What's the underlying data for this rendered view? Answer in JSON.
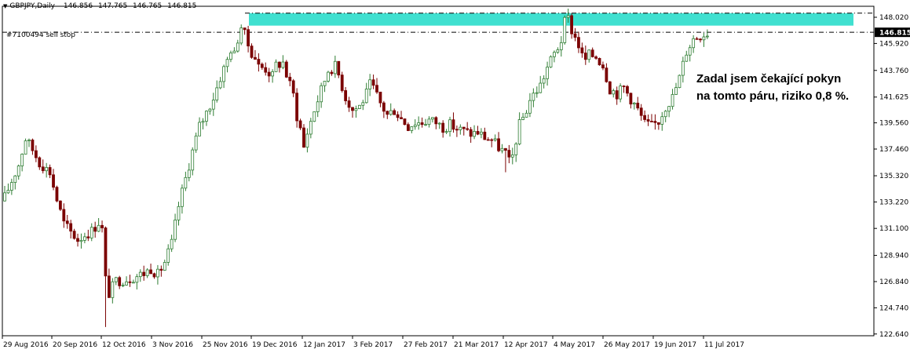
{
  "header": {
    "symbol": "GBPJPY,Daily",
    "ohlc": [
      "146.856",
      "147.765",
      "146.765",
      "146.815"
    ]
  },
  "order": {
    "label": "#7100494 sell stop",
    "price": 146.815
  },
  "annotation": {
    "line1": "Zadal jsem čekající pokyn",
    "line2": "na tomto páru, riziko 0,8 %."
  },
  "zone": {
    "low": 147.35,
    "high": 148.35,
    "color": "#40e0d0"
  },
  "resistance_line": 148.35,
  "current_price": {
    "value": 146.815,
    "label": "146.815"
  },
  "colors": {
    "bull": "#2e7d32",
    "bear": "#7b0000",
    "axis": "#000000",
    "price_box": "#000000"
  },
  "chart_data": {
    "type": "candlestick",
    "title": "GBPJPY,Daily",
    "ylim": [
      122.5,
      148.9
    ],
    "y_ticks": [
      "148.020",
      "145.920",
      "143.760",
      "141.625",
      "139.560",
      "137.460",
      "135.320",
      "133.220",
      "131.100",
      "128.940",
      "126.840",
      "124.740",
      "122.640"
    ],
    "x_ticks": [
      "29 Aug 2016",
      "20 Sep 2016",
      "12 Oct 2016",
      "3 Nov 2016",
      "25 Nov 2016",
      "19 Dec 2016",
      "12 Jan 2017",
      "3 Feb 2017",
      "27 Feb 2017",
      "21 Mar 2017",
      "12 Apr 2017",
      "4 May 2017",
      "26 May 2017",
      "19 Jun 2017",
      "11 Jul 2017"
    ],
    "close_path": [
      [
        0,
        133.6
      ],
      [
        4,
        136.2
      ],
      [
        6,
        138.3
      ],
      [
        8,
        137.4
      ],
      [
        10,
        136.4
      ],
      [
        13,
        135.6
      ],
      [
        15,
        133.4
      ],
      [
        17,
        131.5
      ],
      [
        19,
        130.8
      ],
      [
        21,
        130.2
      ],
      [
        23,
        130.6
      ],
      [
        25,
        130.9
      ],
      [
        27,
        131.6
      ],
      [
        28,
        131.0
      ],
      [
        29,
        127.0
      ],
      [
        30,
        125.9
      ],
      [
        32,
        126.9
      ],
      [
        36,
        127.1
      ],
      [
        40,
        127.5
      ],
      [
        42,
        127.9
      ],
      [
        44,
        127.4
      ],
      [
        46,
        128.4
      ],
      [
        48,
        129.9
      ],
      [
        50,
        132.9
      ],
      [
        52,
        135.1
      ],
      [
        54,
        137.3
      ],
      [
        56,
        139.3
      ],
      [
        58,
        140.4
      ],
      [
        60,
        141.6
      ],
      [
        62,
        143.2
      ],
      [
        64,
        144.6
      ],
      [
        65,
        145.5
      ],
      [
        66,
        145.0
      ],
      [
        67,
        146.3
      ],
      [
        68,
        147.3
      ],
      [
        69,
        146.6
      ],
      [
        70,
        145.8
      ],
      [
        71,
        145.2
      ],
      [
        72,
        144.8
      ],
      [
        73,
        144.1
      ],
      [
        75,
        143.9
      ],
      [
        77,
        143.3
      ],
      [
        78,
        144.2
      ],
      [
        80,
        144.4
      ],
      [
        81,
        143.4
      ],
      [
        83,
        141.8
      ],
      [
        84,
        140.1
      ],
      [
        85,
        139.1
      ],
      [
        86,
        137.6
      ],
      [
        87,
        138.8
      ],
      [
        89,
        140.6
      ],
      [
        91,
        142.2
      ],
      [
        93,
        143.8
      ],
      [
        95,
        144.1
      ],
      [
        96,
        143.4
      ],
      [
        98,
        141.6
      ],
      [
        100,
        140.6
      ],
      [
        102,
        140.9
      ],
      [
        104,
        141.9
      ],
      [
        105,
        142.6
      ],
      [
        106,
        142.3
      ],
      [
        108,
        141.1
      ],
      [
        110,
        140.2
      ],
      [
        112,
        140.6
      ],
      [
        114,
        139.9
      ],
      [
        116,
        139.3
      ],
      [
        118,
        139.6
      ],
      [
        120,
        139.6
      ],
      [
        122,
        139.8
      ],
      [
        124,
        139.6
      ],
      [
        126,
        139.2
      ],
      [
        128,
        139.4
      ],
      [
        130,
        139.1
      ],
      [
        132,
        138.9
      ],
      [
        134,
        138.7
      ],
      [
        136,
        138.8
      ],
      [
        138,
        138.4
      ],
      [
        140,
        138.2
      ],
      [
        142,
        137.6
      ],
      [
        144,
        137.1
      ],
      [
        145,
        136.4
      ],
      [
        146,
        136.9
      ],
      [
        147,
        138.2
      ],
      [
        148,
        139.4
      ],
      [
        150,
        140.6
      ],
      [
        151,
        141.4
      ],
      [
        152,
        141.8
      ],
      [
        154,
        142.6
      ],
      [
        156,
        144.0
      ],
      [
        158,
        145.1
      ],
      [
        159,
        145.6
      ],
      [
        160,
        146.2
      ],
      [
        161,
        147.6
      ],
      [
        162,
        147.9
      ],
      [
        163,
        147.0
      ],
      [
        164,
        146.4
      ],
      [
        165,
        145.8
      ],
      [
        166,
        144.9
      ],
      [
        167,
        144.6
      ],
      [
        168,
        145.0
      ],
      [
        170,
        144.9
      ],
      [
        172,
        144.2
      ],
      [
        174,
        142.3
      ],
      [
        176,
        141.9
      ],
      [
        178,
        142.4
      ],
      [
        180,
        141.5
      ],
      [
        182,
        140.6
      ],
      [
        184,
        139.5
      ],
      [
        186,
        139.3
      ],
      [
        188,
        139.7
      ],
      [
        190,
        140.9
      ],
      [
        192,
        141.6
      ],
      [
        194,
        143.2
      ],
      [
        196,
        145.3
      ],
      [
        198,
        146.3
      ],
      [
        200,
        146.6
      ],
      [
        202,
        146.8
      ]
    ]
  }
}
